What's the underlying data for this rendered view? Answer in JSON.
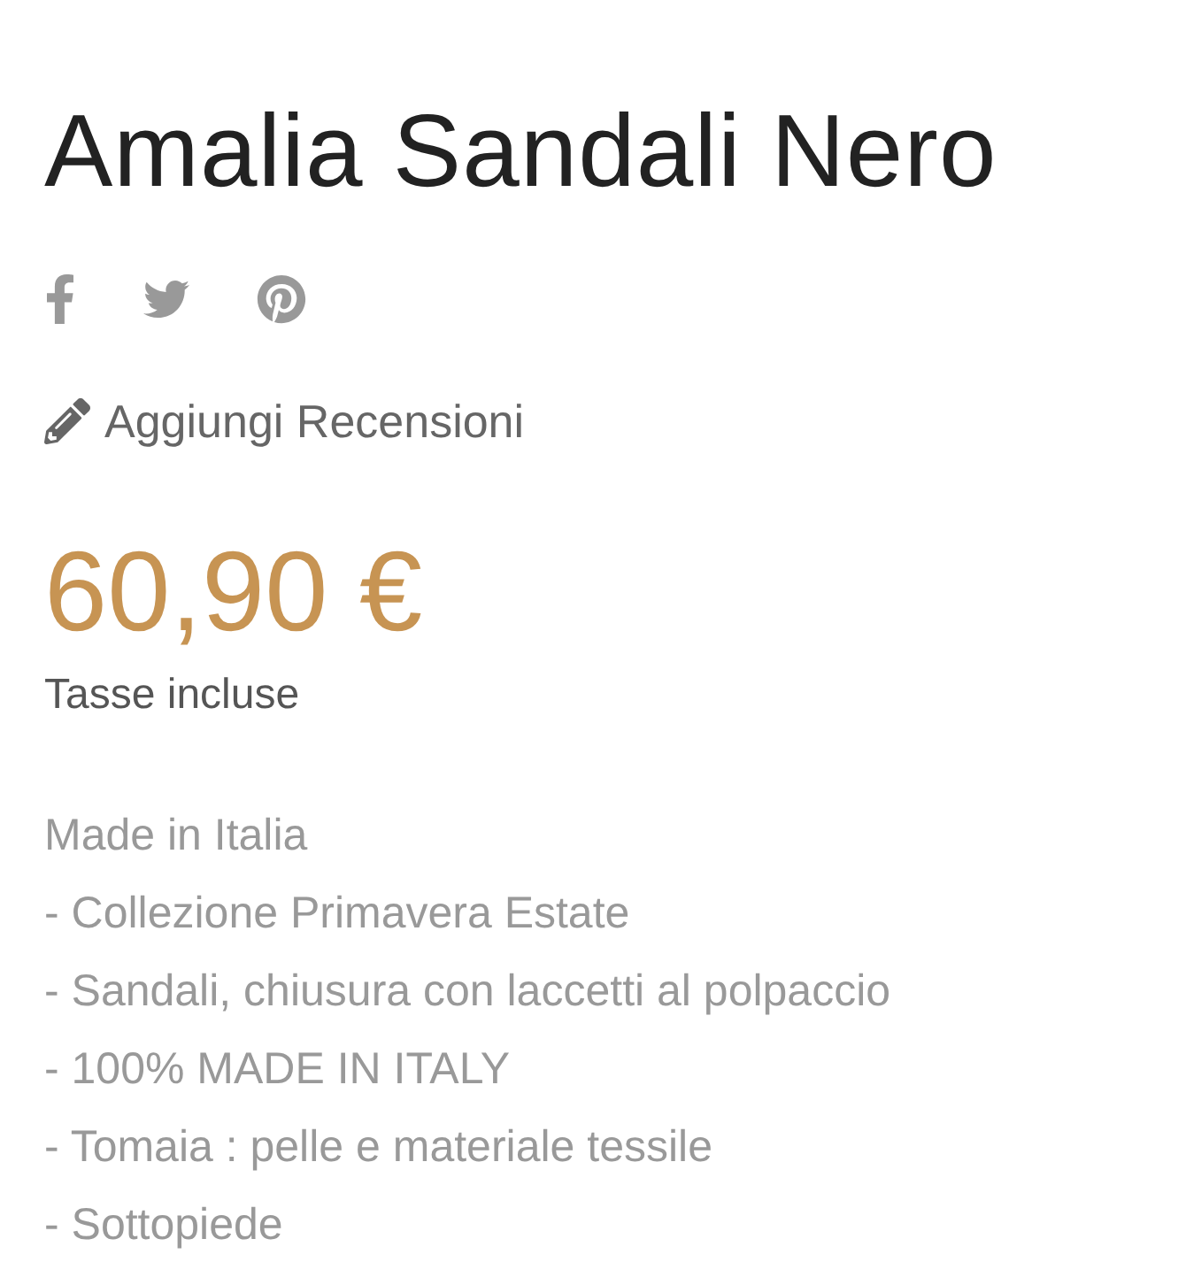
{
  "product": {
    "title": "Amalia Sandali Nero",
    "review_link": "Aggiungi Recensioni",
    "price": "60,90 €",
    "tax_note": "Tasse incluse",
    "description": [
      "Made in Italia",
      "- Collezione Primavera Estate",
      "- Sandali, chiusura con laccetti al polpaccio",
      "- 100% MADE IN ITALY",
      "- Tomaia : pelle e materiale tessile",
      "- Sottopiede"
    ]
  }
}
